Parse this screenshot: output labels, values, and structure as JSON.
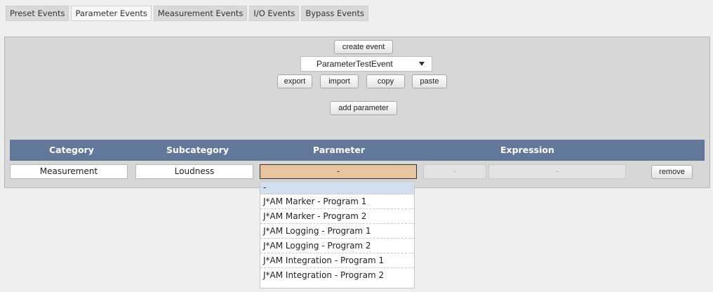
{
  "tabs": [
    "Preset Events",
    "Parameter Events",
    "Measurement Events",
    "I/O Events",
    "Bypass Events"
  ],
  "active_tab": 1,
  "toolbar": {
    "create_event": "create event",
    "event_select_value": "ParameterTestEvent",
    "export": "export",
    "import": "import",
    "copy": "copy",
    "paste": "paste",
    "add_parameter": "add parameter"
  },
  "table": {
    "headers": {
      "category": "Category",
      "subcategory": "Subcategory",
      "parameter": "Parameter",
      "expression": "Expression"
    },
    "row": {
      "category": "Measurement",
      "subcategory": "Loudness",
      "parameter": "-",
      "field_a": "-",
      "expression": "-",
      "remove": "remove"
    }
  },
  "parameter_options": [
    "-",
    "J*AM Marker - Program 1",
    "J*AM Marker - Program 2",
    "J*AM Logging - Program 1",
    "J*AM Logging - Program 2",
    "J*AM Integration - Program 1",
    "J*AM Integration - Program 2"
  ],
  "colors": {
    "header_bg": "#62789a",
    "param_highlight": "#e8c4a1",
    "option_selected": "#d3dfec"
  }
}
